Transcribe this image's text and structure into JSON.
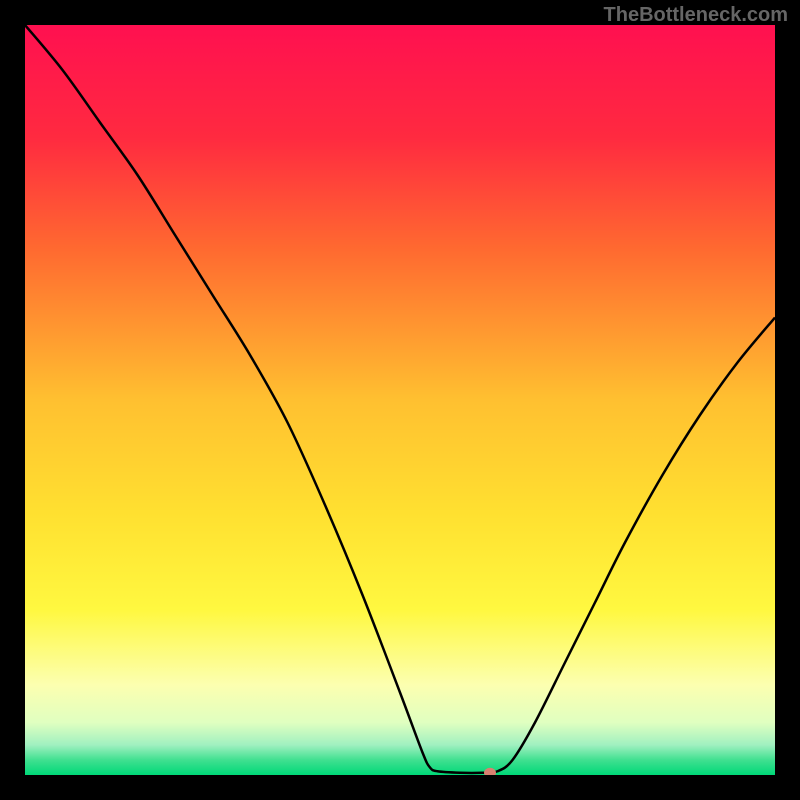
{
  "watermark": "TheBottleneck.com",
  "chart_data": {
    "type": "line",
    "title": "",
    "xlabel": "",
    "ylabel": "",
    "xlim": [
      0,
      100
    ],
    "ylim": [
      0,
      100
    ],
    "gradient_stops": [
      {
        "offset": 0,
        "color": "#ff1050"
      },
      {
        "offset": 15,
        "color": "#ff2a40"
      },
      {
        "offset": 30,
        "color": "#ff6a30"
      },
      {
        "offset": 50,
        "color": "#ffc030"
      },
      {
        "offset": 65,
        "color": "#ffe030"
      },
      {
        "offset": 78,
        "color": "#fff840"
      },
      {
        "offset": 88,
        "color": "#fcffb0"
      },
      {
        "offset": 93,
        "color": "#e0ffc0"
      },
      {
        "offset": 96,
        "color": "#a0f0c0"
      },
      {
        "offset": 98,
        "color": "#40e090"
      },
      {
        "offset": 100,
        "color": "#00d878"
      }
    ],
    "series": [
      {
        "name": "curve",
        "color": "#000000",
        "points": [
          {
            "x": 0,
            "y": 100
          },
          {
            "x": 5,
            "y": 94
          },
          {
            "x": 10,
            "y": 87
          },
          {
            "x": 15,
            "y": 80
          },
          {
            "x": 20,
            "y": 72
          },
          {
            "x": 25,
            "y": 64
          },
          {
            "x": 30,
            "y": 56
          },
          {
            "x": 35,
            "y": 47
          },
          {
            "x": 40,
            "y": 36
          },
          {
            "x": 45,
            "y": 24
          },
          {
            "x": 50,
            "y": 11
          },
          {
            "x": 53,
            "y": 3
          },
          {
            "x": 54,
            "y": 1
          },
          {
            "x": 55,
            "y": 0.5
          },
          {
            "x": 58,
            "y": 0.3
          },
          {
            "x": 61,
            "y": 0.3
          },
          {
            "x": 63,
            "y": 0.5
          },
          {
            "x": 65,
            "y": 2
          },
          {
            "x": 68,
            "y": 7
          },
          {
            "x": 72,
            "y": 15
          },
          {
            "x": 76,
            "y": 23
          },
          {
            "x": 80,
            "y": 31
          },
          {
            "x": 85,
            "y": 40
          },
          {
            "x": 90,
            "y": 48
          },
          {
            "x": 95,
            "y": 55
          },
          {
            "x": 100,
            "y": 61
          }
        ]
      }
    ],
    "marker": {
      "x": 62,
      "y": 0.3,
      "color": "#d88070"
    }
  }
}
